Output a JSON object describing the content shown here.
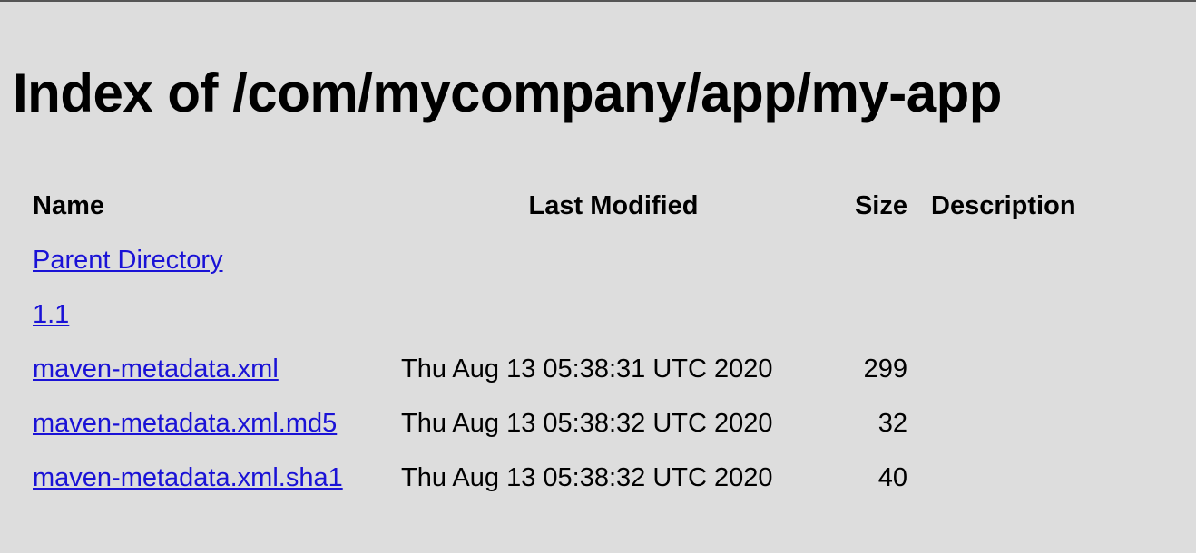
{
  "page": {
    "title": "Index of /com/mycompany/app/my-app"
  },
  "table": {
    "headers": {
      "name": "Name",
      "last_modified": "Last Modified",
      "size": "Size",
      "description": "Description"
    },
    "rows": [
      {
        "name": "Parent Directory",
        "last_modified": "",
        "size": "",
        "description": ""
      },
      {
        "name": "1.1",
        "last_modified": "",
        "size": "",
        "description": ""
      },
      {
        "name": "maven-metadata.xml",
        "last_modified": "Thu Aug 13 05:38:31 UTC 2020",
        "size": "299",
        "description": ""
      },
      {
        "name": "maven-metadata.xml.md5",
        "last_modified": "Thu Aug 13 05:38:32 UTC 2020",
        "size": "32",
        "description": ""
      },
      {
        "name": "maven-metadata.xml.sha1",
        "last_modified": "Thu Aug 13 05:38:32 UTC 2020",
        "size": "40",
        "description": ""
      }
    ]
  },
  "colors": {
    "background": "#dddddd",
    "link": "#1a12d6",
    "text": "#000000"
  }
}
